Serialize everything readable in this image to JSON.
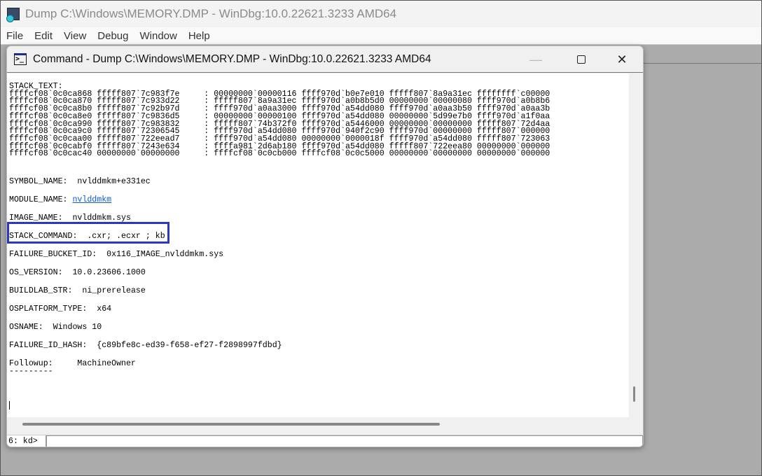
{
  "app": {
    "title": "Dump C:\\Windows\\MEMORY.DMP - WinDbg:10.0.22621.3233 AMD64",
    "menu": [
      "File",
      "Edit",
      "View",
      "Debug",
      "Window",
      "Help"
    ]
  },
  "command_window": {
    "title": "Command - Dump C:\\Windows\\MEMORY.DMP - WinDbg:10.0.22621.3233 AMD64",
    "stack_header": "STACK_TEXT:",
    "stack_rows": [
      "ffffcf08`0c0ca868 fffff807`7c983f7e     : 00000000`00000116 ffff970d`b0e7e010 fffff807`8a9a31ec ffffffff`c00000",
      "ffffcf08`0c0ca870 fffff807`7c933d22     : fffff807`8a9a31ec ffff970d`a0b8b5d0 00000000`00000080 ffff970d`a0b8b6",
      "ffffcf08`0c0ca8b0 fffff807`7c92b97d     : ffff970d`a0aa3000 ffff970d`a54dd080 ffff970d`a0aa3b50 ffff970d`a0aa3b",
      "ffffcf08`0c0ca8e0 fffff807`7c9836d5     : 00000000`00000100 ffff970d`a54dd080 00000000`5d99e7b0 ffff970d`a1f0aa",
      "ffffcf08`0c0ca990 fffff807`7c983832     : fffff807`74b372f0 ffff970d`a5446000 00000000`00000000 fffff807`72d4aa",
      "ffffcf08`0c0ca9c0 fffff807`72306545     : ffff970d`a54dd080 ffff970d`940f2c90 ffff970d`00000000 fffff807`000000",
      "ffffcf08`0c0caa00 fffff807`722eead7     : ffff970d`a54dd080 00000000`0000018f ffff970d`a54dd080 fffff807`723063",
      "ffffcf08`0c0cabf0 fffff807`7243e634     : ffffa981`2d6ab180 ffff970d`a54dd080 fffff807`722eea80 00000000`000000",
      "ffffcf08`0c0cac40 00000000`00000000     : ffffcf08`0c0cb000 ffffcf08`0c0c5000 00000000`00000000 00000000`000000"
    ],
    "fields": [
      {
        "label": "SYMBOL_NAME:  ",
        "value": "nvlddmkm+e331ec"
      },
      {
        "label": "MODULE_NAME: ",
        "value": "nvlddmkm",
        "link": true
      },
      {
        "label": "IMAGE_NAME:  ",
        "value": "nvlddmkm.sys"
      },
      {
        "label": "STACK_COMMAND:  ",
        "value": ".cxr; .ecxr ; kb"
      },
      {
        "label": "FAILURE_BUCKET_ID:  ",
        "value": "0x116_IMAGE_nvlddmkm.sys"
      },
      {
        "label": "OS_VERSION:  ",
        "value": "10.0.23606.1000"
      },
      {
        "label": "BUILDLAB_STR:  ",
        "value": "ni_prerelease"
      },
      {
        "label": "OSPLATFORM_TYPE:  ",
        "value": "x64"
      },
      {
        "label": "OSNAME:  ",
        "value": "Windows 10"
      },
      {
        "label": "FAILURE_ID_HASH:  ",
        "value": "{c89bfe8c-ed39-f658-ef27-f2898997fdbd}"
      },
      {
        "label": "Followup:     ",
        "value": "MachineOwner"
      }
    ],
    "separator": "---------",
    "prompt": "6: kd>",
    "command_value": ""
  }
}
